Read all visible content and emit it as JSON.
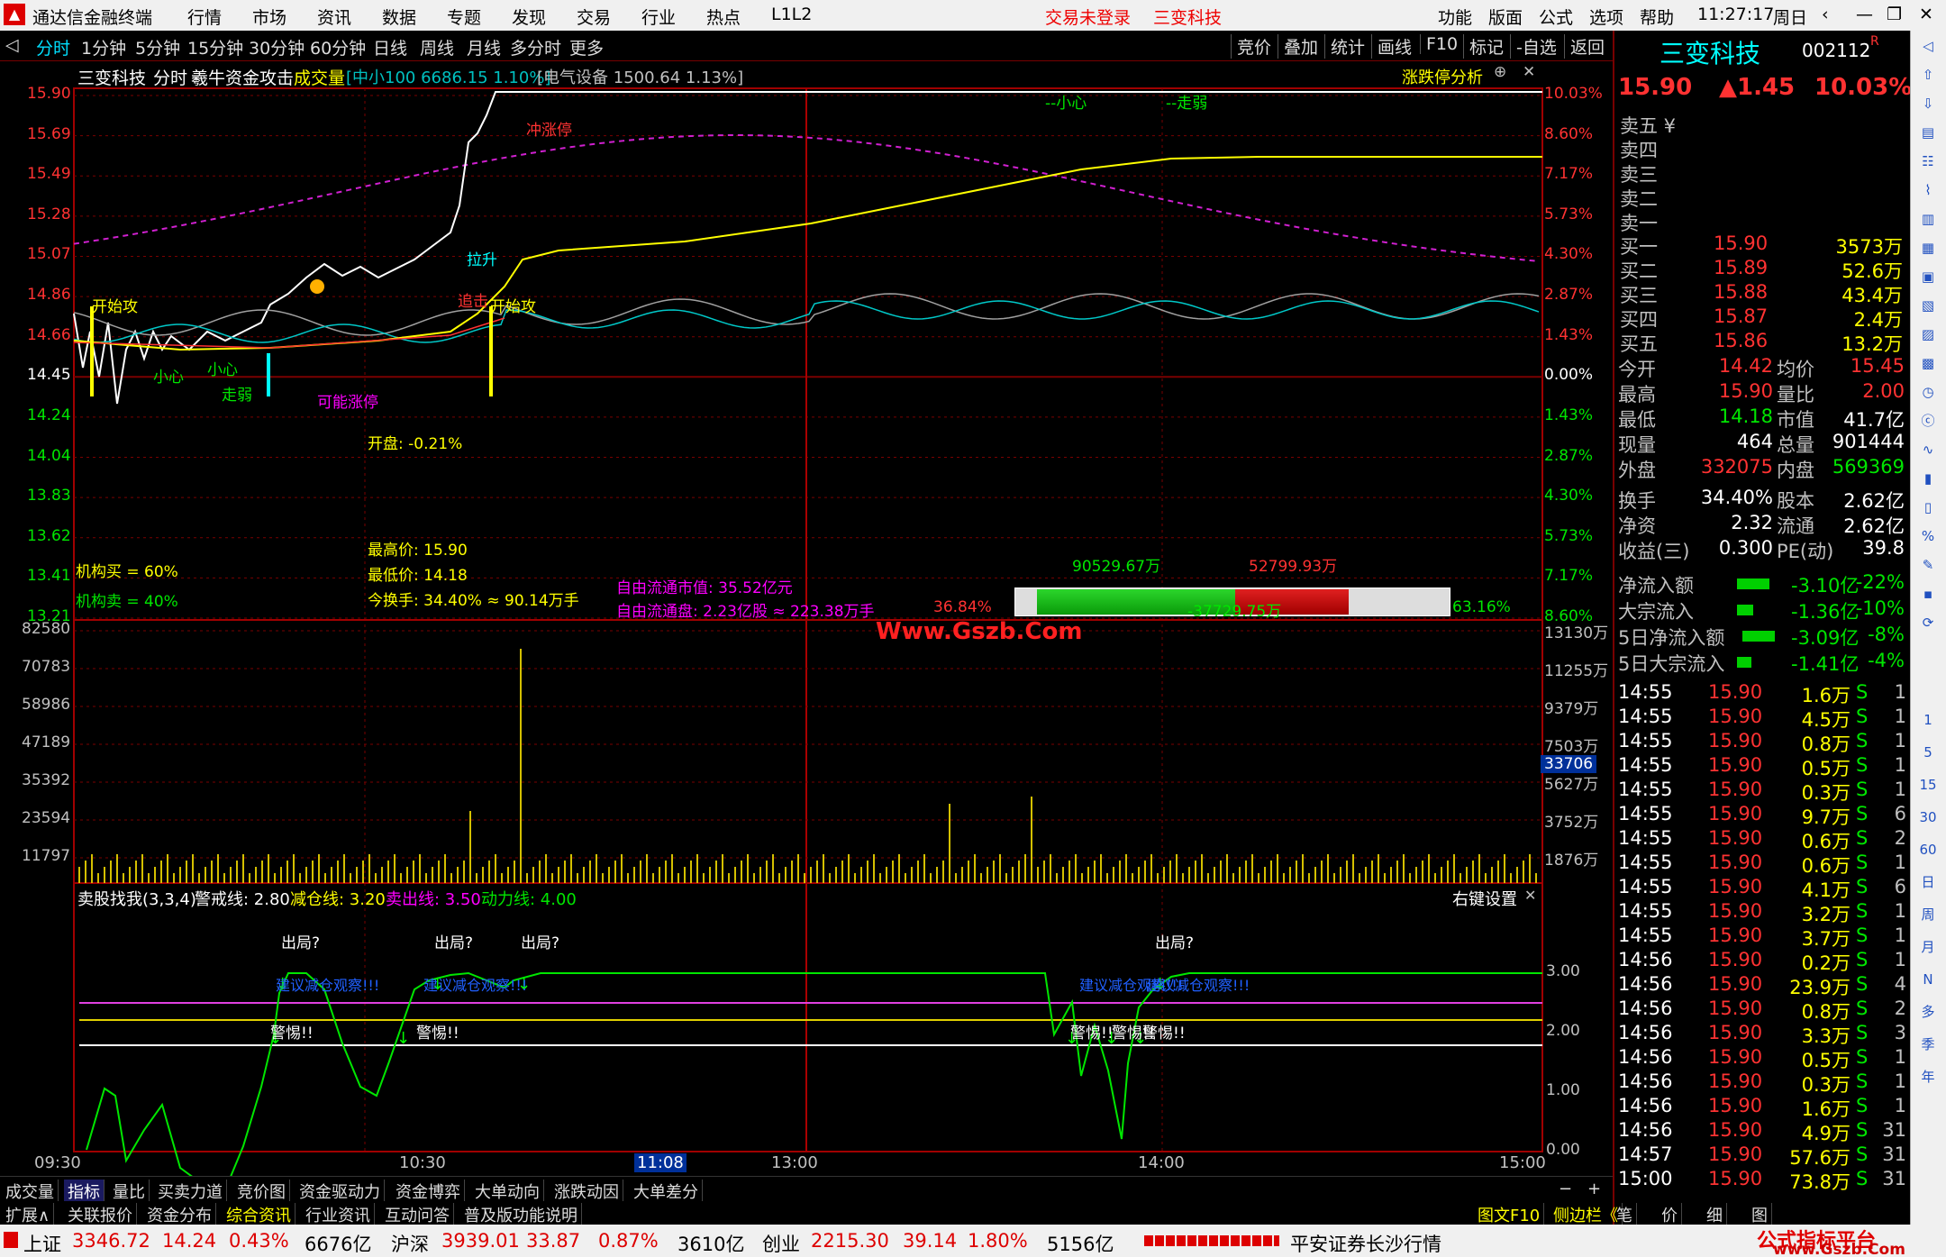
{
  "app": {
    "title": "通达信金融终端",
    "menu": [
      "行情",
      "市场",
      "资讯",
      "数据",
      "专题",
      "发现",
      "交易",
      "行业",
      "热点",
      "L1L2"
    ],
    "login": "交易未登录",
    "stock_short": "三变科技",
    "rightmenu": [
      "功能",
      "版面",
      "公式",
      "选项",
      "帮助"
    ],
    "time": "11:27:17",
    "weekday": "周日"
  },
  "toolbar": {
    "periods": [
      "分时",
      "1分钟",
      "5分钟",
      "15分钟",
      "30分钟",
      "60分钟",
      "日线",
      "周线",
      "月线",
      "多分时",
      "更多"
    ],
    "tools": [
      "竞价",
      "叠加",
      "统计",
      "画线",
      "F10",
      "标记",
      "-自选",
      "返回"
    ]
  },
  "chart": {
    "header": {
      "name": "三变科技",
      "mode": "分时",
      "indicator": "羲牛资金攻击",
      "vol": "成交量",
      "idx1": "[中小100 6686.15 1.10%]",
      "idx2": "[电气设备 1500.64 1.13%]",
      "right": "涨跌停分析"
    },
    "price_ticks": [
      "15.90",
      "15.69",
      "15.49",
      "15.28",
      "15.07",
      "14.86",
      "14.66",
      "14.45",
      "14.24",
      "14.04",
      "13.83",
      "13.62",
      "13.41",
      "13.21"
    ],
    "pct_ticks": [
      "10.03%",
      "8.60%",
      "7.17%",
      "5.73%",
      "4.30%",
      "2.87%",
      "1.43%",
      "0.00%",
      "1.43%",
      "2.87%",
      "4.30%",
      "5.73%",
      "7.17%",
      "8.60%"
    ],
    "vol_ticks": [
      "82580",
      "70783",
      "58986",
      "47189",
      "35392",
      "23594",
      "11797"
    ],
    "vol_ticks_r": [
      "13130万",
      "11255万",
      "9379万",
      "7503万",
      "5627万",
      "3752万",
      "1876万"
    ],
    "vol_marker": "33706",
    "time_ticks": [
      "09:30",
      "10:30",
      "11:08",
      "13:00",
      "14:00",
      "15:00"
    ],
    "annotations": {
      "kai1": "开始攻",
      "kai2": "开始攻",
      "xiaoxin1": "小心",
      "xiaoxin2": "小心",
      "zouruo1": "走弱",
      "kenneng": "可能涨停",
      "zhui": "追击",
      "lasheng": "拉升",
      "chong": "冲涨停",
      "xiaoxin3": "--小心",
      "zouruo2": "--走弱"
    },
    "info": {
      "open": "开盘: -0.21%",
      "high": "最高价: 15.90",
      "low": "最低价: 14.18",
      "turn": "今换手: 34.40% ≈ 90.14万手",
      "mktcap": "自由流通市值: 35.52亿元",
      "float": "自由流通盘: 2.23亿股 ≈ 223.38万手",
      "jgmai": "机构买 = 60%",
      "jgmaichu": "机构卖 = 40%"
    },
    "flow": {
      "buy": "90529.67万",
      "sell": "52799.93万",
      "pct_left": "36.84%",
      "net": "-37729.75万",
      "pct_right": "63.16%"
    },
    "watermark": "Www.Gszb.Com",
    "sub": {
      "title": "卖股找我(3,3,4)",
      "jj": "警戒线: 2.80",
      "jc": "减仓线: 3.20",
      "mc": "卖出线: 3.50",
      "dl": "动力线: 4.00",
      "right": "右键设置",
      "ticks": [
        "3.00",
        "2.00",
        "1.00",
        "0.00"
      ],
      "chuju": "出局?",
      "jingti": "警惕!!",
      "blue": "建议减仓观察!!!"
    }
  },
  "quote": {
    "name": "三变科技",
    "code": "002112",
    "r": "R",
    "price": "15.90",
    "change": "▲1.45",
    "pct": "10.03%",
    "sells": [
      "卖五 ¥",
      "卖四",
      "卖三",
      "卖二",
      "卖一"
    ],
    "buys": [
      [
        "买一",
        "15.90",
        "3573万"
      ],
      [
        "买二",
        "15.89",
        "52.6万"
      ],
      [
        "买三",
        "15.88",
        "43.4万"
      ],
      [
        "买四",
        "15.87",
        "2.4万"
      ],
      [
        "买五",
        "15.86",
        "13.2万"
      ]
    ],
    "stats": [
      [
        "今开",
        "14.42",
        "均价",
        "15.45"
      ],
      [
        "最高",
        "15.90",
        "量比",
        "2.00"
      ],
      [
        "最低",
        "14.18",
        "市值",
        "41.7亿"
      ],
      [
        "现量",
        "464",
        "总量",
        "901444"
      ],
      [
        "外盘",
        "332075",
        "内盘",
        "569369"
      ],
      [
        "换手",
        "34.40%",
        "股本",
        "2.62亿"
      ],
      [
        "净资",
        "2.32",
        "流通",
        "2.62亿"
      ],
      [
        "收益(三)",
        "0.300",
        "PE(动)",
        "39.8"
      ]
    ],
    "flows": [
      [
        "净流入额",
        "-3.10亿",
        "-22%"
      ],
      [
        "大宗流入",
        "-1.36亿",
        "-10%"
      ],
      [
        "5日净流入额",
        "-3.09亿",
        "-8%"
      ],
      [
        "5日大宗流入",
        "-1.41亿",
        "-4%"
      ]
    ],
    "ticks": [
      [
        "14:55",
        "15.90",
        "1.6万",
        "S",
        "1"
      ],
      [
        "14:55",
        "15.90",
        "4.5万",
        "S",
        "1"
      ],
      [
        "14:55",
        "15.90",
        "0.8万",
        "S",
        "1"
      ],
      [
        "14:55",
        "15.90",
        "0.5万",
        "S",
        "1"
      ],
      [
        "14:55",
        "15.90",
        "0.3万",
        "S",
        "1"
      ],
      [
        "14:55",
        "15.90",
        "9.7万",
        "S",
        "6"
      ],
      [
        "14:55",
        "15.90",
        "0.6万",
        "S",
        "2"
      ],
      [
        "14:55",
        "15.90",
        "0.6万",
        "S",
        "1"
      ],
      [
        "14:55",
        "15.90",
        "4.1万",
        "S",
        "6"
      ],
      [
        "14:55",
        "15.90",
        "3.2万",
        "S",
        "1"
      ],
      [
        "14:55",
        "15.90",
        "3.7万",
        "S",
        "1"
      ],
      [
        "14:56",
        "15.90",
        "0.2万",
        "S",
        "1"
      ],
      [
        "14:56",
        "15.90",
        "23.9万",
        "S",
        "4"
      ],
      [
        "14:56",
        "15.90",
        "0.8万",
        "S",
        "2"
      ],
      [
        "14:56",
        "15.90",
        "3.3万",
        "S",
        "3"
      ],
      [
        "14:56",
        "15.90",
        "0.5万",
        "S",
        "1"
      ],
      [
        "14:56",
        "15.90",
        "0.3万",
        "S",
        "1"
      ],
      [
        "14:56",
        "15.90",
        "1.6万",
        "S",
        "1"
      ],
      [
        "14:56",
        "15.90",
        "4.9万",
        "S",
        "31"
      ],
      [
        "14:57",
        "15.90",
        "57.6万",
        "S",
        "31"
      ],
      [
        "15:00",
        "15.90",
        "73.8万",
        "S",
        "31"
      ]
    ]
  },
  "vsidebar": [
    "1",
    "5",
    "15",
    "30",
    "60",
    "日",
    "周",
    "月",
    "N",
    "多",
    "季",
    "年"
  ],
  "bottomtabs": [
    "成交量",
    "指标",
    "量比",
    "买卖力道",
    "竞价图",
    "资金驱动力",
    "资金博弈",
    "大单动向",
    "涨跌动因",
    "大单差分"
  ],
  "bottom2": [
    "扩展∧",
    "关联报价",
    "资金分布",
    "综合资讯",
    "行业资讯",
    "互动问答",
    "普及版功能说明"
  ],
  "bottom2r": [
    "图文F10",
    "侧边栏《",
    "笔",
    "价",
    "细",
    "图"
  ],
  "statusbar": {
    "sh": [
      "上证",
      "3346.72",
      "14.24",
      "0.43%",
      "6676亿"
    ],
    "hs": [
      "沪深",
      "3939.01",
      "33.87",
      "0.87%",
      "3610亿"
    ],
    "cy": [
      "创业",
      "2215.30",
      "39.14",
      "1.80%",
      "5156亿"
    ],
    "broker": "平安证券长沙行情",
    "brand": "公式指标平台",
    "brand_url": "www.Gszb.Com"
  }
}
